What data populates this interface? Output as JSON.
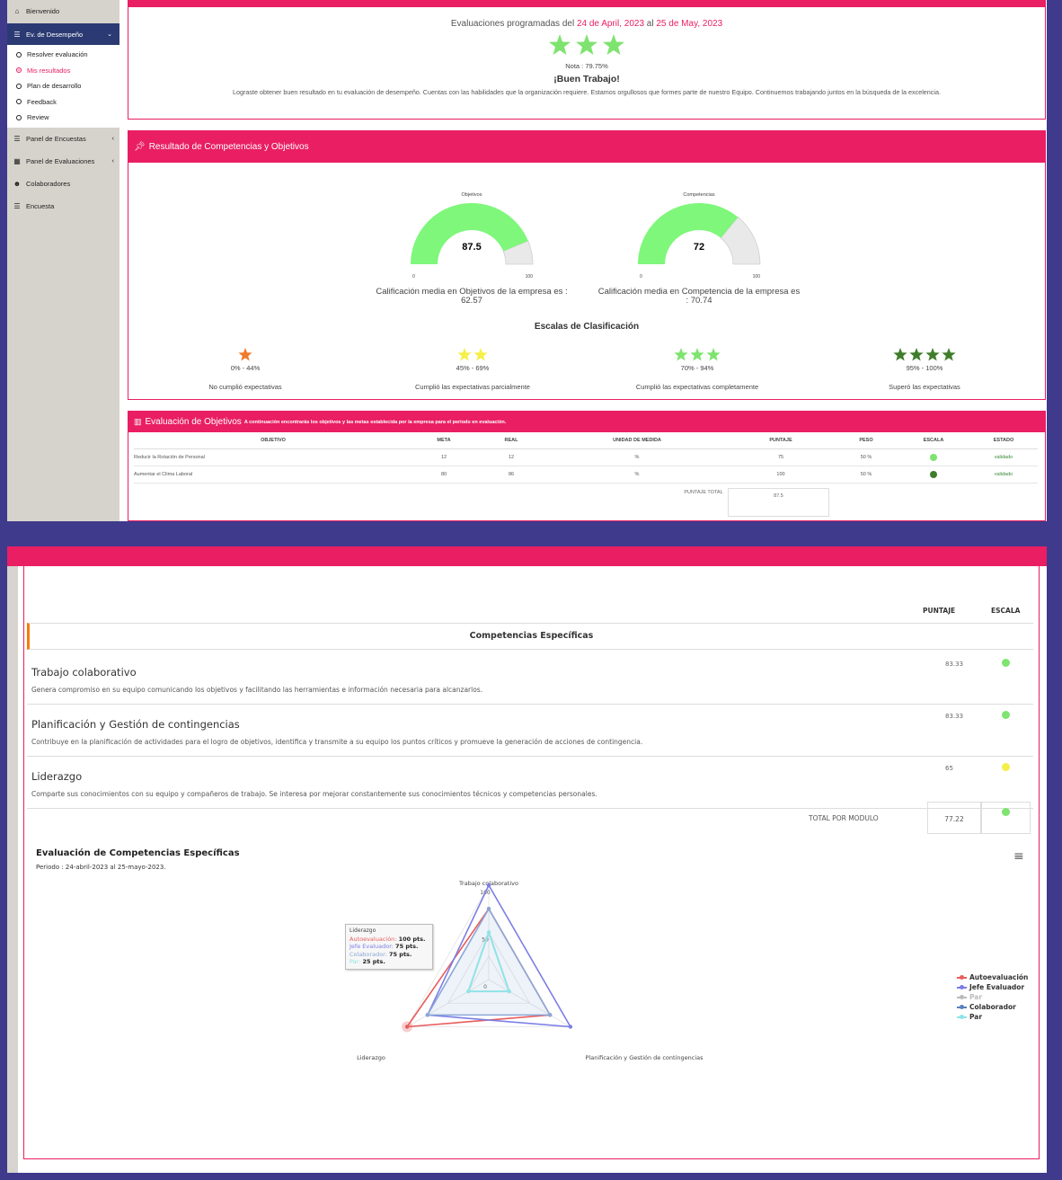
{
  "sidebar": {
    "items": [
      {
        "label": "Bienvenido",
        "icon": "home-icon"
      },
      {
        "label": "Ev. de Desempeño",
        "icon": "list-icon"
      },
      {
        "label": "Panel de Encuestas",
        "icon": "menu-icon"
      },
      {
        "label": "Panel de Evaluaciones",
        "icon": "calendar-icon"
      },
      {
        "label": "Colaboradores",
        "icon": "users-icon"
      },
      {
        "label": "Encuesta",
        "icon": "menu-icon"
      }
    ],
    "subitems": [
      "Resolver evaluación",
      "Mis resultados",
      "Plan de desarrollo",
      "Feedback",
      "Review"
    ]
  },
  "summary": {
    "scheduled_prefix": "Evaluaciones programadas del",
    "date_from": "24 de April, 2023",
    "conj": "al",
    "date_to": "25 de May, 2023",
    "note": "Nota : 79.75%",
    "headline": "¡Buen Trabajo!",
    "message": "Lograste obtener buen resultado en tu evaluación de desempeño. Cuentas con las habilidades que la organización requiere. Estamos orgullosos que formes parte de nuestro Equipo. Continuemos trabajando juntos en la búsqueda de la excelencia."
  },
  "results": {
    "header": "Resultado de Competencias y Objetivos",
    "gauges": [
      {
        "title": "Objetivos",
        "value": "87.5",
        "min": "0",
        "max": "100",
        "fraction": 0.875
      },
      {
        "title": "Competencias",
        "value": "72",
        "min": "0",
        "max": "100",
        "fraction": 0.72
      }
    ],
    "avg_obj_line1": "Calificación media en Objetivos de la empresa es :",
    "avg_obj_line2": "62.57",
    "avg_comp_line1": "Calificación media en Competencia de la empresa es",
    "avg_comp_line2": ": 70.74",
    "scales_title": "Escalas de Clasificación",
    "scales": [
      {
        "range": "0% - 44%",
        "label": "No cumplió expectativas",
        "stars": 1,
        "color": "#f07b2a"
      },
      {
        "range": "45% - 69%",
        "label": "Cumplió las expectativas parcialmente",
        "stars": 2,
        "color": "#f5ef4a"
      },
      {
        "range": "70% - 94%",
        "label": "Cumplió las expectativas completamente",
        "stars": 3,
        "color": "#7ee36f"
      },
      {
        "range": "95% - 100%",
        "label": "Superó las expectativas",
        "stars": 4,
        "color": "#3f7d2a"
      }
    ]
  },
  "objectives": {
    "header_title": "Evaluación de Objetivos",
    "header_sub": "A continuación encontrarás los objetivos y las metas establecida por la empresa para el periodo en evaluación.",
    "columns": [
      "OBJETIVO",
      "META",
      "REAL",
      "UNIDAD DE MEDIDA",
      "PUNTAJE",
      "PESO",
      "ESCALA",
      "ESTADO"
    ],
    "rows": [
      {
        "objetivo": "Reducir la Rotación de Personal",
        "meta": "12",
        "real": "12",
        "unidad": "%",
        "puntaje": "75",
        "peso": "50 %",
        "escala_color": "#7ee36f",
        "estado": "validado"
      },
      {
        "objetivo": "Aumentar el Clima Laboral",
        "meta": "80",
        "real": "86",
        "unidad": "%",
        "puntaje": "100",
        "peso": "50 %",
        "escala_color": "#3f7d2a",
        "estado": "validado"
      }
    ],
    "total_label": "PUNTAJE TOTAL",
    "total_value": "87.5"
  },
  "competencies": {
    "col_puntaje": "PUNTAJE",
    "col_escala": "ESCALA",
    "section_title": "Competencias Específicas",
    "items": [
      {
        "name": "Trabajo colaborativo",
        "desc": "Genera compromiso en su equipo comunicando los objetivos y facilitando las herramientas e información necesaria para alcanzarlos.",
        "score": "83.33",
        "color": "#7ee36f"
      },
      {
        "name": "Planificación y Gestión de contingencias",
        "desc": "Contribuye en la planificación de actividades para el logro de objetivos, identifica y transmite a su equipo los puntos críticos y promueve la generación de acciones de contingencia.",
        "score": "83.33",
        "color": "#7ee36f"
      },
      {
        "name": "Liderazgo",
        "desc": "Comparte sus conocimientos con su equipo y compañeros de trabajo. Se interesa por mejorar constantemente sus conocimientos técnicos y competencias personales.",
        "score": "65",
        "color": "#f5ef4a"
      }
    ],
    "total_label": "TOTAL POR MODULO",
    "total_value": "77.22",
    "total_color": "#7ee36f"
  },
  "radar": {
    "title": "Evaluación de Competencias Específicas",
    "period": "Periodo : 24-abril-2023 al 25-mayo-2023.",
    "menu_icon": "hamburger-icon",
    "tooltip": {
      "title": "Liderazgo",
      "lines": [
        {
          "label": "Autoevaluación:",
          "value": "100 pts.",
          "color": "#e85c5c"
        },
        {
          "label": "Jefe Evaluador:",
          "value": "75 pts.",
          "color": "#7b7ee6"
        },
        {
          "label": "Colaborador:",
          "value": "75 pts.",
          "color": "#8ba7d6"
        },
        {
          "label": "Par:",
          "value": "25 pts.",
          "color": "#8fe3e6"
        }
      ]
    },
    "legend": [
      {
        "name": "Autoevaluación",
        "color": "#e85c5c",
        "dim": false
      },
      {
        "name": "Jefe Evaluador",
        "color": "#7b7ee6",
        "dim": false
      },
      {
        "name": "Par",
        "color": "#bbbbbb",
        "dim": true
      },
      {
        "name": "Colaborador",
        "color": "#5b7fbf",
        "dim": false
      },
      {
        "name": "Par",
        "color": "#8fe3e6",
        "dim": false
      }
    ]
  },
  "chart_data": {
    "type": "radar",
    "title": "Evaluación de Competencias Específicas",
    "categories": [
      "Trabajo colaborativo",
      "Planificación y Gestión de contingencias",
      "Liderazgo"
    ],
    "tick_labels": [
      "0",
      "50",
      "100"
    ],
    "ylim": [
      0,
      100
    ],
    "series": [
      {
        "name": "Autoevaluación",
        "values": [
          75,
          75,
          100
        ]
      },
      {
        "name": "Jefe Evaluador",
        "values": [
          100,
          100,
          75
        ]
      },
      {
        "name": "Colaborador",
        "values": [
          75,
          75,
          75
        ]
      },
      {
        "name": "Par",
        "values": [
          50,
          25,
          25
        ]
      }
    ]
  }
}
